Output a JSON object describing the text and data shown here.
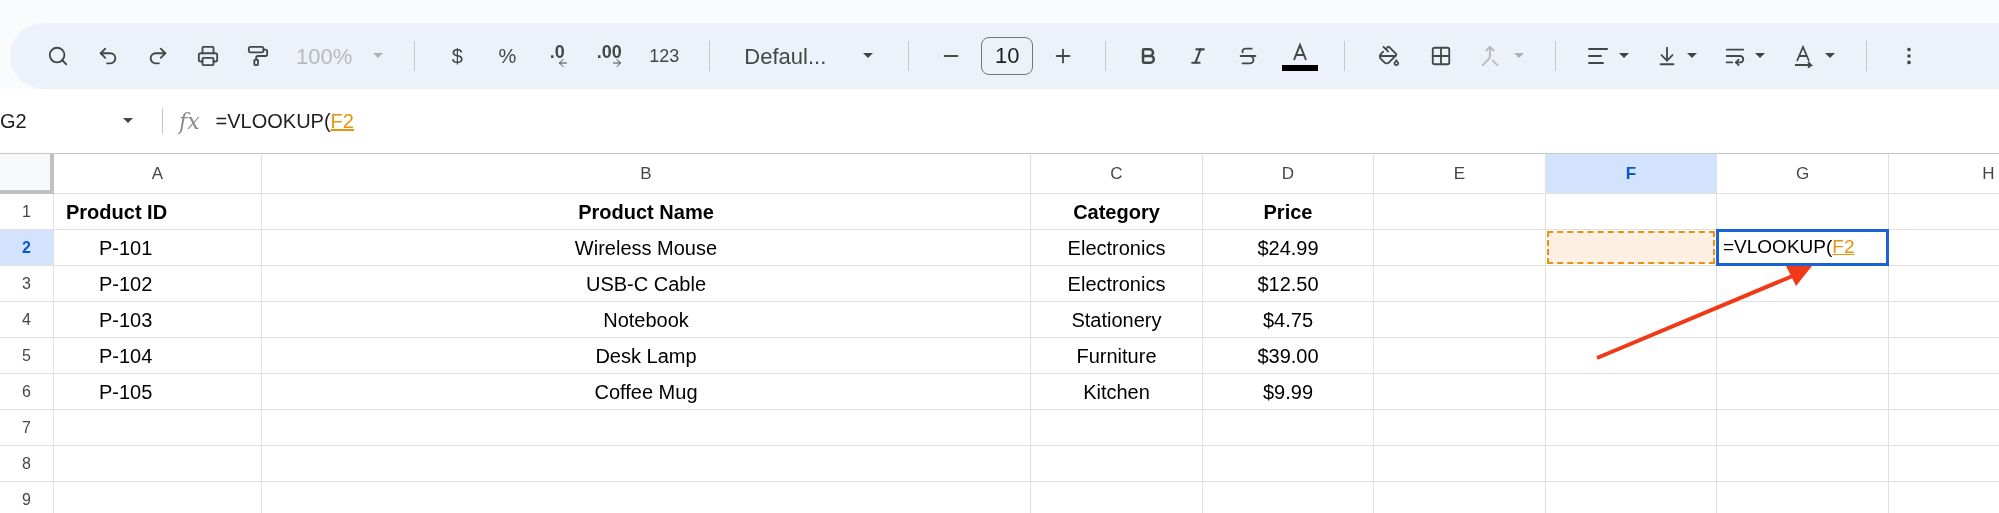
{
  "toolbar": {
    "zoom": {
      "label": "100%",
      "disabled": true
    },
    "currency": "$",
    "percent": "%",
    "decrease_decimals": ".0",
    "increase_decimals": ".00",
    "number_format": "123",
    "font": "Defaul...",
    "font_size": "10",
    "merge": {
      "disabled": true
    }
  },
  "formula_bar": {
    "cell_ref": "G2",
    "fx_label": "fx",
    "parts": [
      {
        "text": "=VLOOKUP(",
        "kind": "plain"
      },
      {
        "text": "F2",
        "kind": "reference"
      }
    ]
  },
  "columns": [
    {
      "label": "A",
      "selected": false
    },
    {
      "label": "B",
      "selected": false
    },
    {
      "label": "C",
      "selected": false
    },
    {
      "label": "D",
      "selected": false
    },
    {
      "label": "E",
      "selected": false
    },
    {
      "label": "F",
      "selected": true
    },
    {
      "label": "G",
      "selected": false
    },
    {
      "label": "H",
      "selected": false
    }
  ],
  "rows": [
    {
      "label": "1",
      "selected": false,
      "kind": "header",
      "cells": [
        {
          "text": "Product ID"
        },
        {
          "text": "Product Name"
        },
        {
          "text": "Category"
        },
        {
          "text": "Price"
        }
      ]
    },
    {
      "label": "2",
      "selected": true,
      "kind": "data",
      "cells": [
        {
          "text": "P-101"
        },
        {
          "text": "Wireless Mouse"
        },
        {
          "text": "Electronics"
        },
        {
          "text": "$24.99"
        },
        {
          "kind": "empty"
        },
        {
          "kind": "reference"
        },
        {
          "kind": "editor",
          "parts": [
            {
              "text": "=VLOOKUP(",
              "kind": "plain"
            },
            {
              "text": "F2",
              "kind": "reference"
            }
          ]
        }
      ]
    },
    {
      "label": "3",
      "selected": false,
      "kind": "data",
      "cells": [
        {
          "text": "P-102"
        },
        {
          "text": "USB-C Cable"
        },
        {
          "text": "Electronics"
        },
        {
          "text": "$12.50"
        }
      ]
    },
    {
      "label": "4",
      "selected": false,
      "kind": "data",
      "cells": [
        {
          "text": "P-103"
        },
        {
          "text": "Notebook"
        },
        {
          "text": "Stationery"
        },
        {
          "text": "$4.75"
        }
      ]
    },
    {
      "label": "5",
      "selected": false,
      "kind": "data",
      "cells": [
        {
          "text": "P-104"
        },
        {
          "text": "Desk Lamp"
        },
        {
          "text": "Furniture"
        },
        {
          "text": "$39.00"
        }
      ]
    },
    {
      "label": "6",
      "selected": false,
      "kind": "data",
      "cells": [
        {
          "text": "P-105"
        },
        {
          "text": "Coffee Mug"
        },
        {
          "text": "Kitchen"
        },
        {
          "text": "$9.99"
        }
      ]
    },
    {
      "label": "7",
      "selected": false
    },
    {
      "label": "8",
      "selected": false
    },
    {
      "label": "9",
      "selected": false
    }
  ]
}
